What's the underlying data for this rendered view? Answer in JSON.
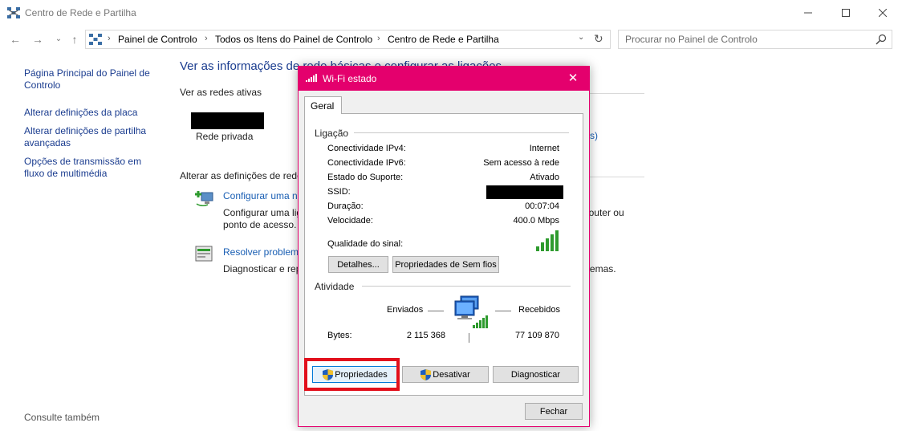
{
  "window": {
    "title": "Centro de Rede e Partilha"
  },
  "address": {
    "crumbs": [
      "Painel de Controlo",
      "Todos os Itens do Painel de Controlo",
      "Centro de Rede e Partilha"
    ]
  },
  "search": {
    "placeholder": "Procurar no Painel de Controlo"
  },
  "sidebar": {
    "items": [
      {
        "label": "Página Principal do Painel de Controlo"
      },
      {
        "label": "Alterar definições da placa"
      },
      {
        "label": "Alterar definições de partilha avançadas"
      },
      {
        "label": "Opções de transmissão em fluxo de multimédia"
      }
    ],
    "see_also": "Consulte também"
  },
  "main": {
    "heading": "Ver as informações de rede básicas e configurar as ligações",
    "active_networks": "Ver as redes ativas",
    "network_type": "Rede privada",
    "partial_link": "s)",
    "change_settings": "Alterar as definições de rede",
    "setup_link": "Configurar uma nova ligação ou rede",
    "setup_desc_1": "Configurar uma ligação de banda larga, acesso telefónico ou VPN; ou configurar um router ou",
    "setup_desc_2": "ponto de acesso.",
    "troubleshoot_link": "Resolver problemas",
    "troubleshoot_desc": "Diagnosticar e reparar problemas de rede ou obter informações de resolução de problemas."
  },
  "dialog": {
    "title": "Wi-Fi estado",
    "tab": "Geral",
    "connection_group": "Ligação",
    "rows": [
      {
        "label": "Conectividade IPv4:",
        "value": "Internet"
      },
      {
        "label": "Conectividade IPv6:",
        "value": "Sem acesso à rede"
      },
      {
        "label": "Estado do Suporte:",
        "value": "Ativado"
      },
      {
        "label": "SSID:",
        "value": ""
      },
      {
        "label": "Duração:",
        "value": "00:07:04"
      },
      {
        "label": "Velocidade:",
        "value": "400.0 Mbps"
      }
    ],
    "signal_label": "Qualidade do sinal:",
    "signal_bars": 5,
    "details_button": "Detalhes...",
    "wireless_props_button": "Propriedades de Sem fios",
    "activity_group": "Atividade",
    "sent_label": "Enviados",
    "received_label": "Recebidos",
    "bytes_label": "Bytes:",
    "bytes_sent": "2 115 368",
    "bytes_received": "77 109 870",
    "properties_button": "Propriedades",
    "disable_button": "Desativar",
    "diagnose_button": "Diagnosticar",
    "close_button": "Fechar"
  },
  "colors": {
    "accent": "#e4006d",
    "link": "#1a3c8f",
    "highlight": "#e2101c",
    "signal": "#2e9b2e"
  }
}
